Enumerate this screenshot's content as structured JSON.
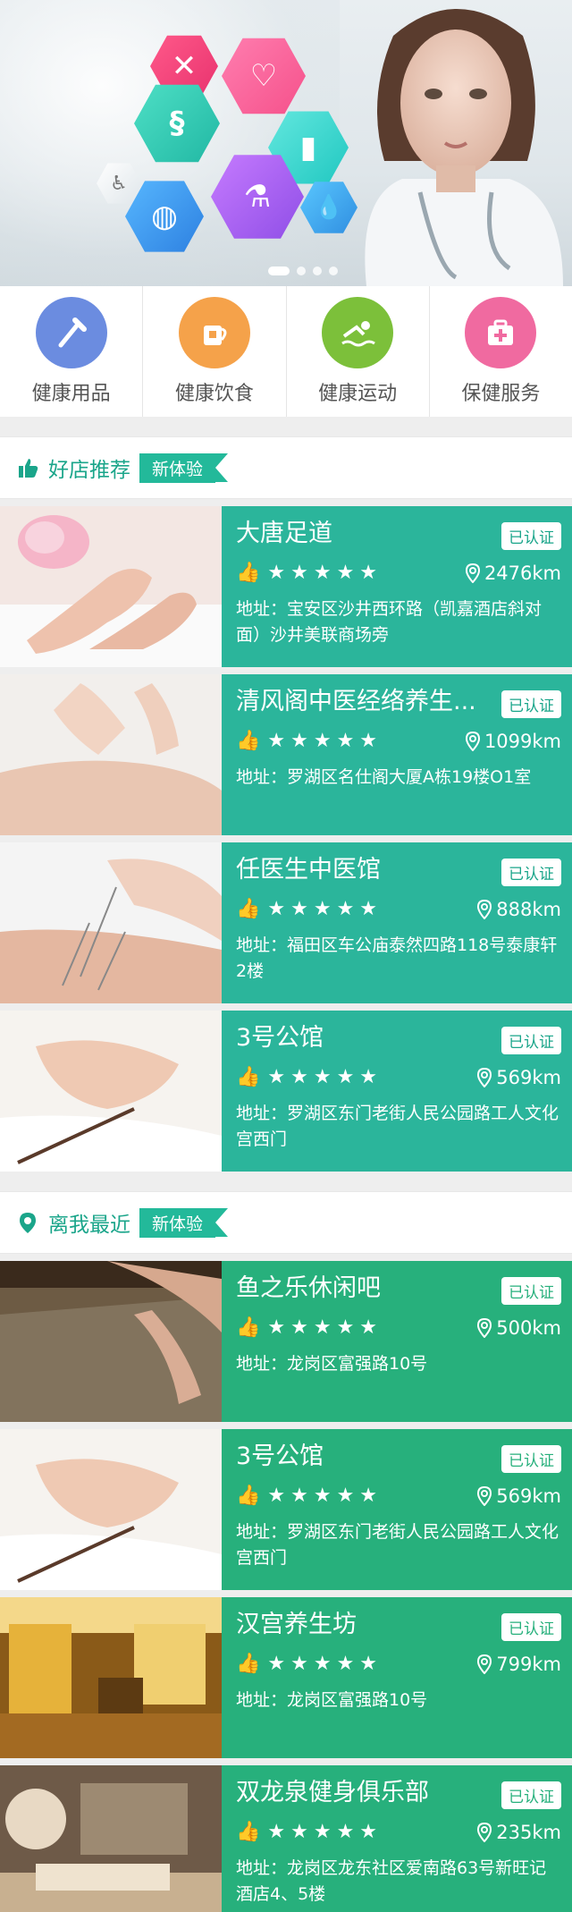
{
  "hero": {
    "dots_total": 4,
    "dots_active_index": 0
  },
  "categories": [
    {
      "label": "健康用品",
      "icon": "toothbrush-icon",
      "color": "#6b8ce0"
    },
    {
      "label": "健康饮食",
      "icon": "cup-icon",
      "color": "#f5a24a"
    },
    {
      "label": "健康运动",
      "icon": "swimmer-icon",
      "color": "#7cc03a"
    },
    {
      "label": "保健服务",
      "icon": "medkit-icon",
      "color": "#f06aa0"
    }
  ],
  "recommended": {
    "title": "好店推荐",
    "badge": "新体验",
    "shops": [
      {
        "name": "大唐足道",
        "verified": "已认证",
        "stars": "★★★★★",
        "distance": "2476km",
        "address": "地址：宝安区沙井西环路（凯嘉酒店斜对面）沙井美联商场旁"
      },
      {
        "name": "清风阁中医经络养生...",
        "verified": "已认证",
        "stars": "★★★★★",
        "distance": "1099km",
        "address": "地址：罗湖区名仕阁大厦A栋19楼O1室"
      },
      {
        "name": "任医生中医馆",
        "verified": "已认证",
        "stars": "★★★★★",
        "distance": "888km",
        "address": "地址：福田区车公庙泰然四路118号泰康轩2楼"
      },
      {
        "name": "3号公馆",
        "verified": "已认证",
        "stars": "★★★★★",
        "distance": "569km",
        "address": "地址：罗湖区东门老街人民公园路工人文化宫西门"
      }
    ]
  },
  "nearby": {
    "title": "离我最近",
    "badge": "新体验",
    "shops": [
      {
        "name": "鱼之乐休闲吧",
        "verified": "已认证",
        "stars": "★★★★★",
        "distance": "500km",
        "address": "地址：龙岗区富强路10号"
      },
      {
        "name": "3号公馆",
        "verified": "已认证",
        "stars": "★★★★★",
        "distance": "569km",
        "address": "地址：罗湖区东门老街人民公园路工人文化宫西门"
      },
      {
        "name": "汉宫养生坊",
        "verified": "已认证",
        "stars": "★★★★★",
        "distance": "799km",
        "address": "地址：龙岗区富强路10号"
      },
      {
        "name": "双龙泉健身俱乐部",
        "verified": "已认证",
        "stars": "★★★★★",
        "distance": "235km",
        "address": "地址：龙岗区龙东社区爱南路63号新旺记酒店4、5楼"
      }
    ]
  },
  "colors": {
    "teal": "#2bb59b",
    "green": "#27b07c",
    "accent": "#1aa58a"
  }
}
